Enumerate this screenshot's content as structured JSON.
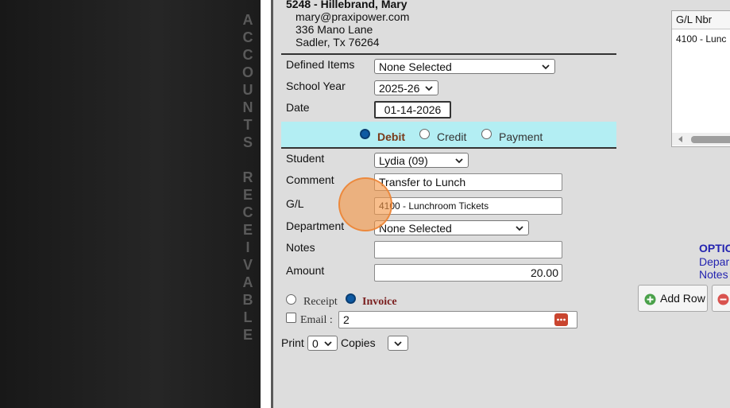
{
  "sidebar_vertical_text": [
    "A",
    "C",
    "C",
    "O",
    "U",
    "N",
    "T",
    "S",
    "",
    "R",
    "E",
    "C",
    "E",
    "I",
    "V",
    "A",
    "B",
    "L",
    "E"
  ],
  "header": {
    "account_title": "5248 - Hillebrand, Mary",
    "email": "mary@praxipower.com",
    "address1": "336 Mano Lane",
    "address2": "Sadler, Tx 76264"
  },
  "form": {
    "defined_items_label": "Defined Items",
    "defined_items_value": "None Selected",
    "school_year_label": "School Year",
    "school_year_value": "2025-26",
    "date_label": "Date",
    "date_value": "01-14-2026",
    "type_options": {
      "debit": "Debit",
      "credit": "Credit",
      "payment": "Payment",
      "selected": "Debit"
    },
    "student_label": "Student",
    "student_value": "Lydia (09)",
    "comment_label": "Comment",
    "comment_value": "Transfer to Lunch",
    "gl_label": "G/L",
    "gl_value": "4100 - Lunchroom Tickets",
    "department_label": "Department",
    "department_value": "None Selected",
    "notes_label": "Notes",
    "notes_value": "",
    "amount_label": "Amount",
    "amount_value": "20.00",
    "receipt_label": "Receipt",
    "invoice_label": "Invoice",
    "receipt_invoice_selected": "Invoice",
    "email_label": "Email :",
    "email_value": "2",
    "print_label": "Print",
    "print_value": "0",
    "copies_label": "Copies",
    "copies_value": ""
  },
  "grid": {
    "column_header": "G/L Nbr",
    "row1": "4100 - Lunc"
  },
  "options": {
    "title": "OPTIC",
    "link1": "Depar",
    "link2": "Notes"
  },
  "buttons": {
    "add_row": "Add Row"
  },
  "colors": {
    "dark_panel": "#1f1f1f",
    "radio_band": "#b3eef3",
    "options_blue": "#2323b0",
    "invoice_color": "#7a1e1e",
    "click_marker": "#f4a15a"
  }
}
